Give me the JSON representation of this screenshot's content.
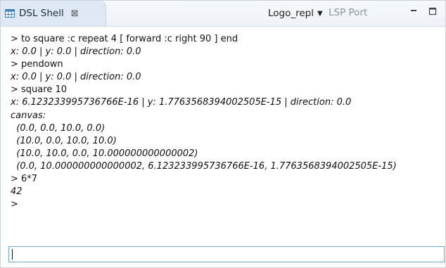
{
  "tab": {
    "title": "DSL Shell",
    "close_glyph": "⊠",
    "icon": "table-icon"
  },
  "toolbar": {
    "repl_selector": "Logo_repl",
    "lsp_port_label": "LSP Port"
  },
  "output_lines": [
    {
      "text": "> to square :c repeat 4 [ forward :c right 90 ] end",
      "kind": "input"
    },
    {
      "text": "x: 0.0 | y: 0.0 | direction: 0.0",
      "kind": "result"
    },
    {
      "text": "> pendown",
      "kind": "input"
    },
    {
      "text": "x: 0.0 | y: 0.0 | direction: 0.0",
      "kind": "result"
    },
    {
      "text": "> square 10",
      "kind": "input"
    },
    {
      "text": "x: 6.123233995736766E-16 | y: 1.7763568394002505E-15 | direction: 0.0",
      "kind": "result"
    },
    {
      "text": "canvas:",
      "kind": "result"
    },
    {
      "text": "  (0.0, 0.0, 10.0, 0.0)",
      "kind": "result"
    },
    {
      "text": "  (10.0, 0.0, 10.0, 10.0)",
      "kind": "result"
    },
    {
      "text": "  (10.0, 10.0, 0.0, 10.000000000000002)",
      "kind": "result"
    },
    {
      "text": "  (0.0, 10.000000000000002, 6.123233995736766E-16, 1.7763568394002505E-15)",
      "kind": "result"
    },
    {
      "text": "> 6*7",
      "kind": "input"
    },
    {
      "text": "42",
      "kind": "result"
    },
    {
      "text": ">",
      "kind": "input"
    }
  ],
  "command_input": {
    "value": "",
    "placeholder": ""
  },
  "colors": {
    "tab_bg": "#dfe9f6",
    "input_border": "#6aa7e4",
    "muted_text": "#8a939c"
  }
}
